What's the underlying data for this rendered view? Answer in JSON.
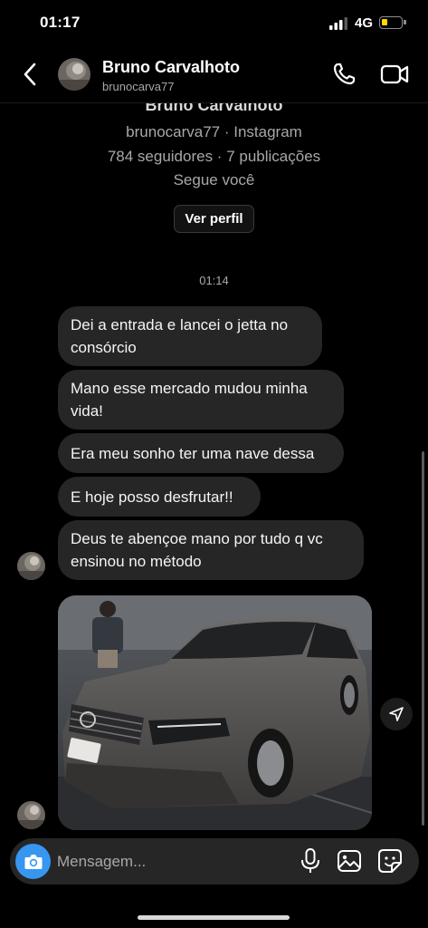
{
  "status_bar": {
    "time": "01:17",
    "network": "4G",
    "battery_level": 0.3,
    "icons": [
      "cellular-signal-icon",
      "battery-icon"
    ]
  },
  "header": {
    "name": "Bruno Carvalhoto",
    "username": "brunocarva77",
    "icons": [
      "back-arrow-icon",
      "phone-icon",
      "video-camera-icon"
    ]
  },
  "profile": {
    "name": "Bruno Carvalhoto",
    "handle_line": "brunocarva77 · Instagram",
    "stats_line": "784 seguidores · 7 publicações",
    "follow_status": "Segue você",
    "view_profile_label": "Ver perfil"
  },
  "conversation": {
    "timestamp": "01:14",
    "messages": [
      {
        "text": "Dei a entrada e lancei o jetta no consórcio"
      },
      {
        "text": "Mano esse mercado mudou minha vida!"
      },
      {
        "text": "Era meu sonho ter uma nave dessa"
      },
      {
        "text": "E hoje posso desfrutar!!"
      },
      {
        "text": "Deus te abençoe mano por tudo q vc ensinou no método"
      }
    ],
    "photo_subject": "gray sedan car photo"
  },
  "composer": {
    "placeholder": "Mensagem...",
    "icons": [
      "camera-icon",
      "microphone-icon",
      "gallery-icon",
      "sticker-icon"
    ]
  },
  "colors": {
    "background": "#000000",
    "bubble": "#262626",
    "accent": "#3797f0",
    "battery": "#ffd60a",
    "secondary_text": "#a8a8a8"
  }
}
